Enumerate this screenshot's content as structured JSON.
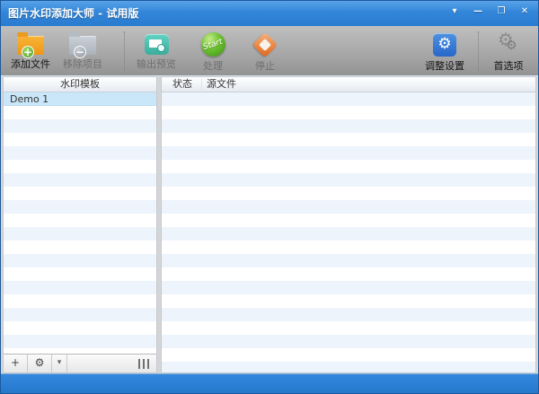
{
  "window": {
    "title": "图片水印添加大师 - 试用版",
    "controls": {
      "menu": "▾",
      "minimize": "—",
      "maximize": "❐",
      "close": "✕"
    }
  },
  "toolbar": {
    "buttons": [
      {
        "label": "添加文件",
        "enabled": true,
        "icon": "add-files-icon",
        "badge": "+"
      },
      {
        "label": "移除项目",
        "enabled": false,
        "icon": "remove-items-icon",
        "badge": "−"
      },
      {
        "label": "输出预览",
        "enabled": false,
        "icon": "output-preview-icon"
      },
      {
        "label": "处理",
        "enabled": false,
        "icon": "process-start-icon",
        "icon_text": "Start"
      },
      {
        "label": "停止",
        "enabled": false,
        "icon": "stop-icon"
      },
      {
        "label": "调整设置",
        "enabled": true,
        "icon": "adjust-settings-icon",
        "glyph": "⚙"
      },
      {
        "label": "首选项",
        "enabled": true,
        "icon": "preferences-icon",
        "glyph": "⚙"
      }
    ]
  },
  "left_panel": {
    "header": "水印模板",
    "items": [
      {
        "name": "Demo 1",
        "selected": true
      }
    ],
    "footer": {
      "add": "+",
      "settings_glyph": "⚙",
      "dropdown": "▾"
    }
  },
  "right_panel": {
    "columns": [
      "状态",
      "源文件"
    ],
    "rows": []
  },
  "colors": {
    "titlebar_blue": "#2e7fd4",
    "statusbar_blue": "#2a7fd4",
    "toolbar_gray_top": "#bfbfbf",
    "toolbar_gray_bottom": "#939393",
    "selected_row": "#c9e7f8",
    "stripe_row": "#eef4fc",
    "folder_orange": "#ee9718",
    "badge_green": "#55a22b",
    "preview_teal": "#3aad9c",
    "start_green": "#6cc030",
    "stop_orange": "#df6620",
    "settings_blue": "#2767c9"
  }
}
